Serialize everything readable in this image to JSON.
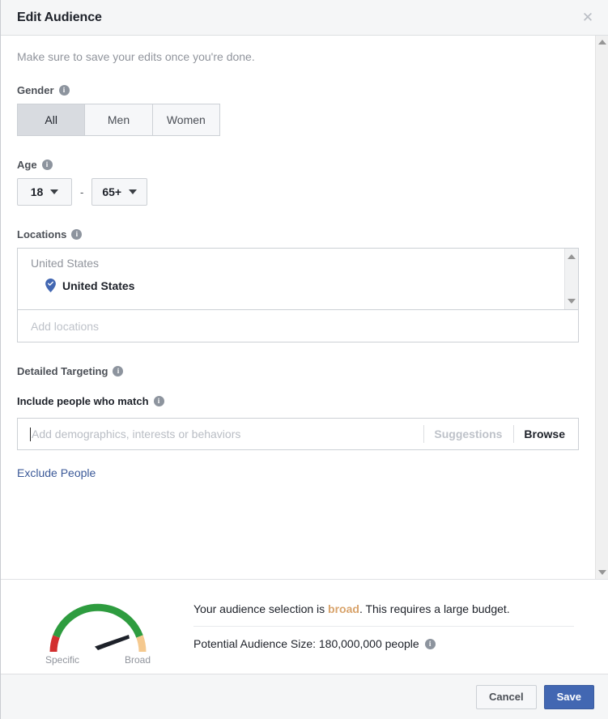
{
  "header": {
    "title": "Edit Audience",
    "close_label": "✕"
  },
  "intro": "Make sure to save your edits once you're done.",
  "gender": {
    "label": "Gender",
    "options": [
      "All",
      "Men",
      "Women"
    ],
    "selected": "All"
  },
  "age": {
    "label": "Age",
    "min": "18",
    "max": "65+",
    "separator": "-"
  },
  "locations": {
    "label": "Locations",
    "group_title": "United States",
    "items": [
      {
        "name": "United States",
        "icon": "map-pin-icon"
      }
    ],
    "add_placeholder": "Add locations"
  },
  "detailed_targeting": {
    "label": "Detailed Targeting",
    "include_label": "Include people who match",
    "input_placeholder": "Add demographics, interests or behaviors",
    "suggestions_label": "Suggestions",
    "browse_label": "Browse",
    "exclude_label": "Exclude People"
  },
  "audience_meter": {
    "left_caption": "Specific",
    "right_caption": "Broad",
    "summary_prefix": "Your audience selection is ",
    "summary_highlight": "broad",
    "summary_suffix": ". This requires a large budget.",
    "size_label": "Potential Audience Size: 180,000,000 people",
    "colors": {
      "low": "#d32f2f",
      "mid": "#2e9c3f",
      "high": "#f5c98f",
      "needle": "#1d2129",
      "highlight": "#d8a36b"
    }
  },
  "actions": {
    "cancel_label": "Cancel",
    "save_label": "Save",
    "save_color": "#4267b2"
  }
}
